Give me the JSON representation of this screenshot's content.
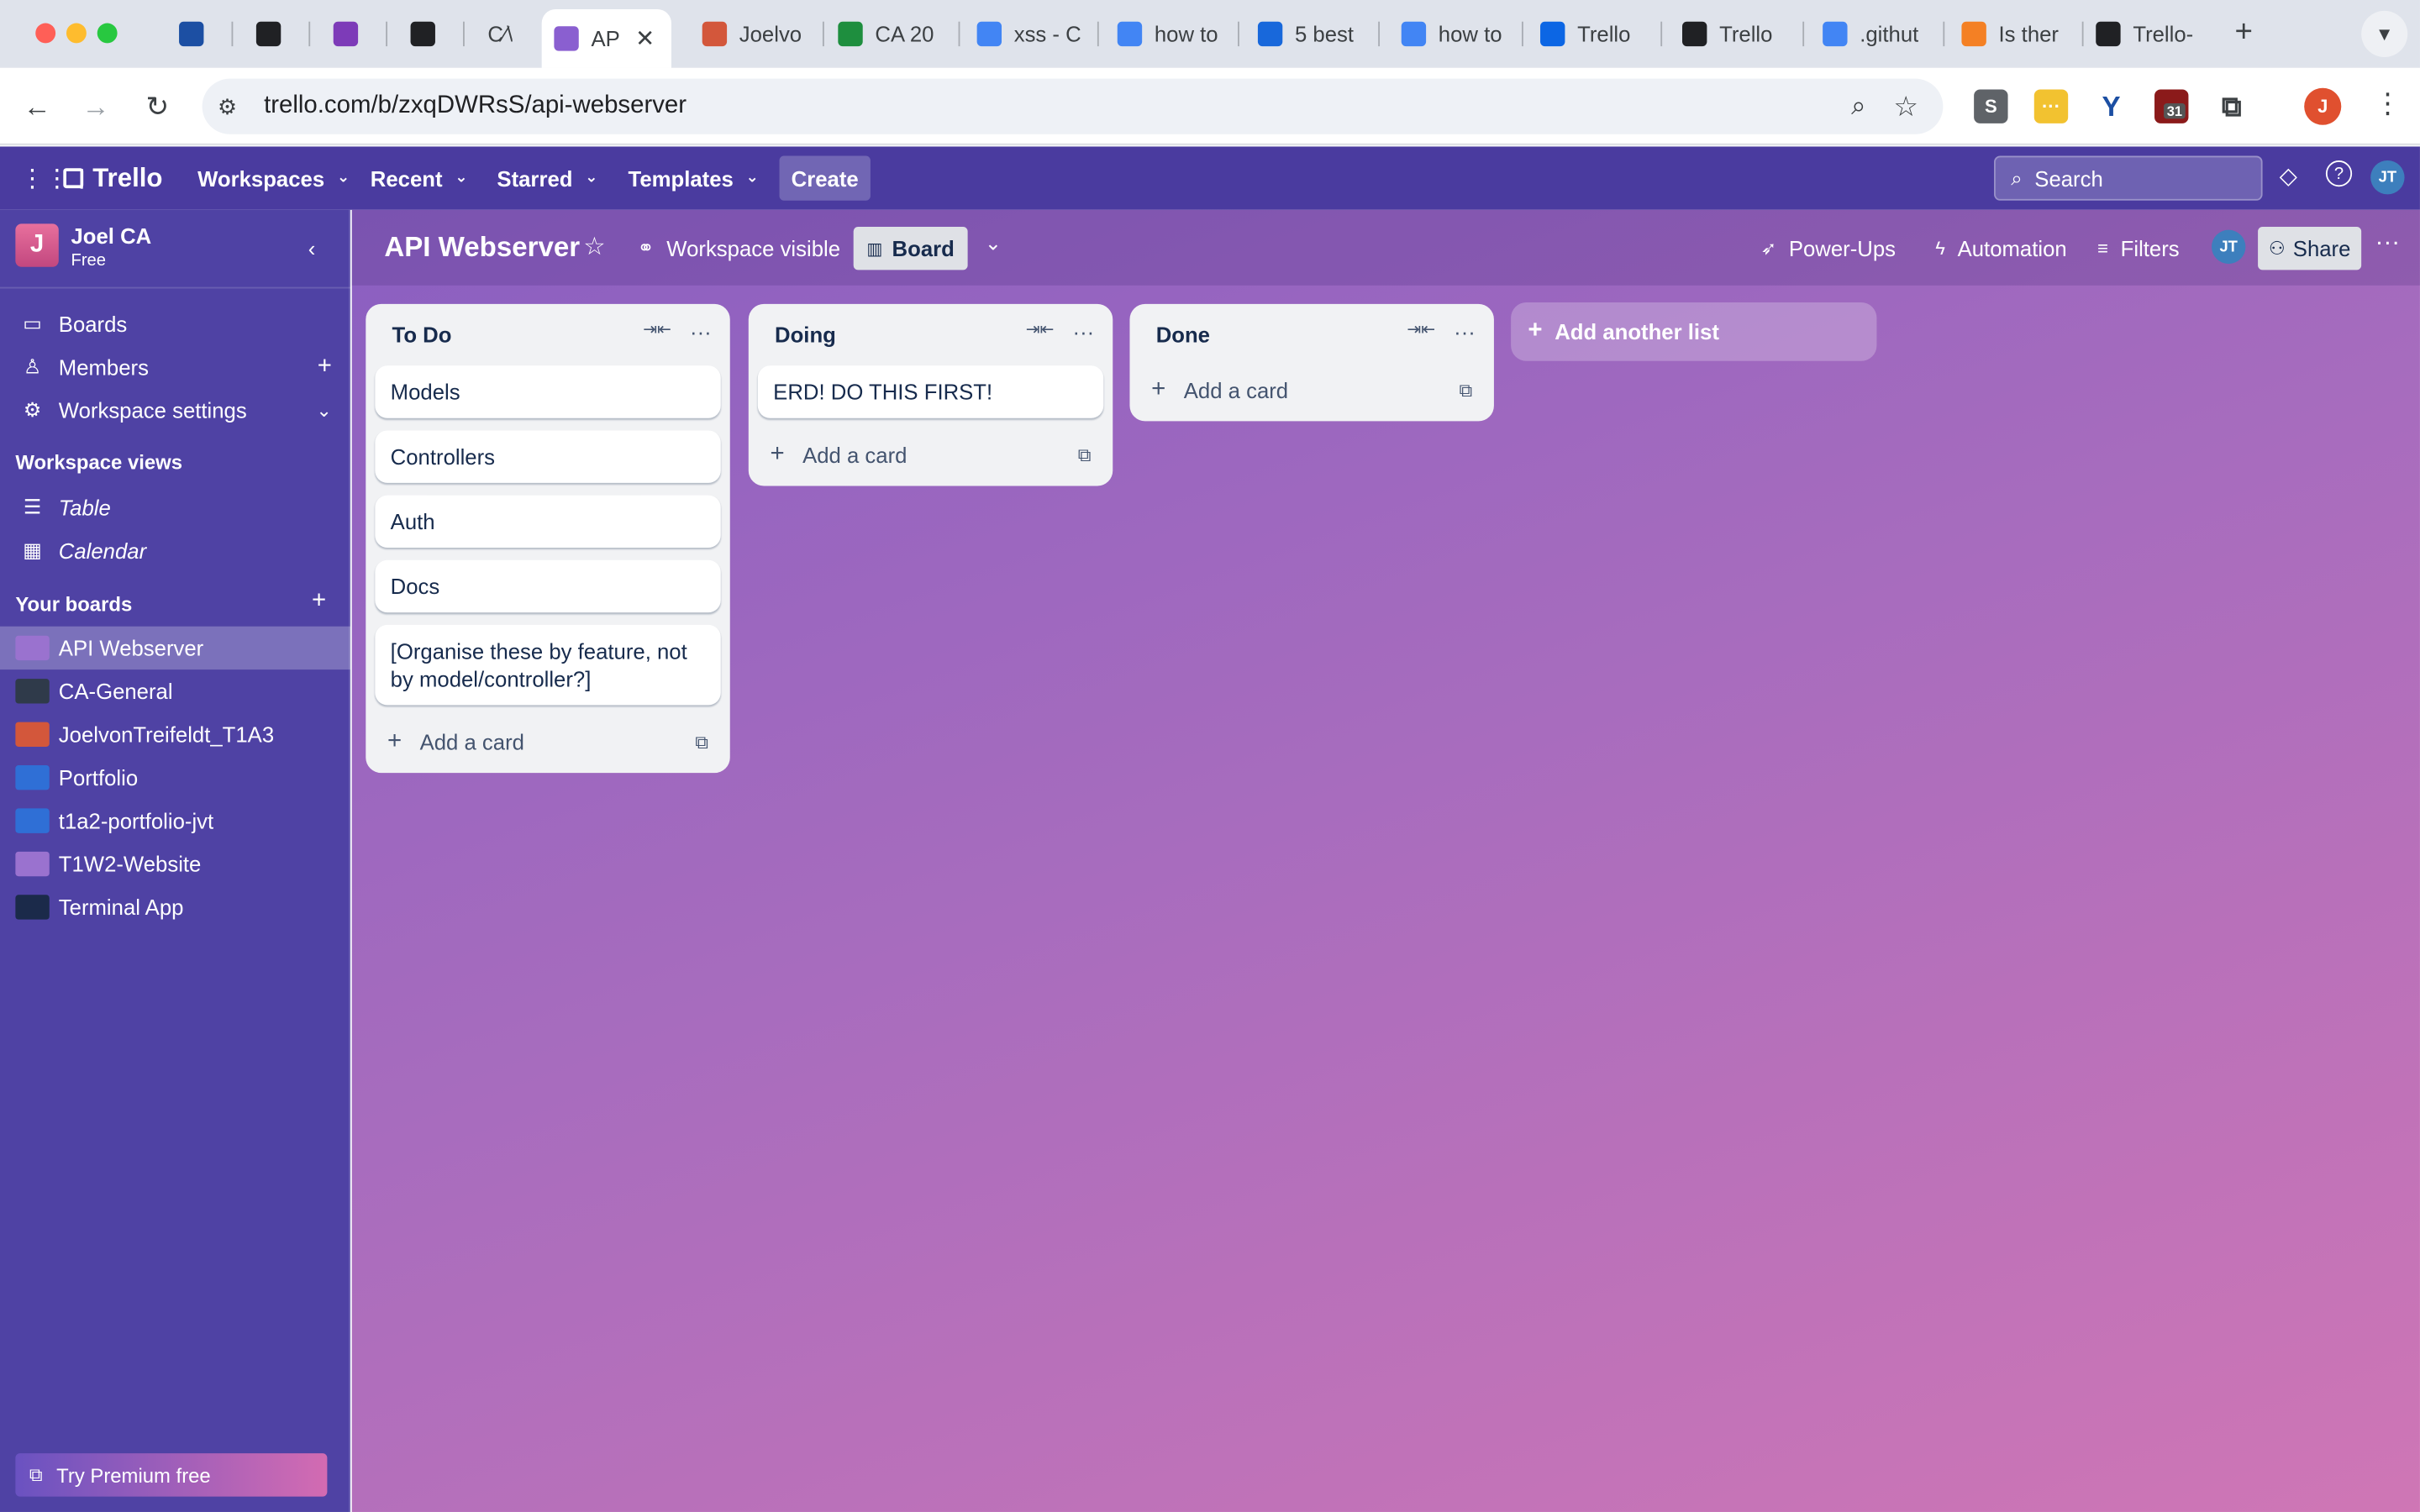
{
  "browser": {
    "tabs": [
      {
        "title": "",
        "icon": "y-logo-icon",
        "color": "#1c4fa3"
      },
      {
        "title": "",
        "icon": "openai-icon",
        "color": "#202124"
      },
      {
        "title": "",
        "icon": "ed-icon",
        "color": "#7d3bb8"
      },
      {
        "title": "",
        "icon": "github-icon",
        "color": "#202124"
      },
      {
        "title": "C⁄\\",
        "icon": "",
        "color": "#888"
      },
      {
        "title": "AP",
        "icon": "trello-icon",
        "color": "#8a5fd0",
        "active": true
      },
      {
        "title": "Joelvo",
        "icon": "trello-orange-icon",
        "color": "#d3573b"
      },
      {
        "title": "CA 20",
        "icon": "sheets-icon",
        "color": "#1e8e3e"
      },
      {
        "title": "xss - C",
        "icon": "google-icon",
        "color": "#4285f4"
      },
      {
        "title": "how to",
        "icon": "google-icon",
        "color": "#4285f4"
      },
      {
        "title": "5 best",
        "icon": "atlassian-icon",
        "color": "#1868db"
      },
      {
        "title": "how to",
        "icon": "google-icon",
        "color": "#4285f4"
      },
      {
        "title": "Trello",
        "icon": "trello-icon",
        "color": "#0c66e4"
      },
      {
        "title": "Trello",
        "icon": "github-icon",
        "color": "#202124"
      },
      {
        "title": ".githut",
        "icon": "google-icon",
        "color": "#4285f4"
      },
      {
        "title": "Is ther",
        "icon": "stackoverflow-icon",
        "color": "#f48024"
      },
      {
        "title": "Trello-",
        "icon": "github-icon",
        "color": "#202124"
      }
    ],
    "url": "trello.com/b/zxqDWRsS/api-webserver",
    "extensions": [
      "S",
      "···",
      "",
      "31",
      ""
    ],
    "profile_initial": "J"
  },
  "header": {
    "app_name": "Trello",
    "menus": [
      "Workspaces",
      "Recent",
      "Starred",
      "Templates"
    ],
    "create_label": "Create",
    "search_placeholder": "Search",
    "avatar": "JT"
  },
  "sidebar": {
    "workspace_initial": "J",
    "workspace_name": "Joel CA",
    "workspace_plan": "Free",
    "nav": [
      {
        "label": "Boards",
        "icon": "board-icon"
      },
      {
        "label": "Members",
        "icon": "person-icon"
      },
      {
        "label": "Workspace settings",
        "icon": "gear-icon"
      }
    ],
    "views_title": "Workspace views",
    "views": [
      {
        "label": "Table",
        "icon": "table-icon"
      },
      {
        "label": "Calendar",
        "icon": "calendar-icon"
      }
    ],
    "boards_title": "Your boards",
    "boards": [
      {
        "label": "API Webserver",
        "color": "#9a72cf",
        "active": true
      },
      {
        "label": "CA-General",
        "color": "#2f3a4a"
      },
      {
        "label": "JoelvonTreifeldt_T1A3",
        "color": "#d3573b"
      },
      {
        "label": "Portfolio",
        "color": "#2f6fd6"
      },
      {
        "label": "t1a2-portfolio-jvt",
        "color": "#2f6fd6"
      },
      {
        "label": "T1W2-Website",
        "color": "#9a72cf"
      },
      {
        "label": "Terminal App",
        "color": "#1b2a4a"
      }
    ],
    "premium_label": "Try Premium free"
  },
  "board": {
    "title": "API Webserver",
    "visibility": "Workspace visible",
    "view": "Board",
    "power_ups": "Power-Ups",
    "automation": "Automation",
    "filters": "Filters",
    "member_avatar": "JT",
    "share": "Share",
    "lists": [
      {
        "title": "To Do",
        "cards": [
          "Models",
          "Controllers",
          "Auth",
          "Docs",
          "[Organise these by feature, not by model/controller?]"
        ]
      },
      {
        "title": "Doing",
        "cards": [
          "ERD! DO THIS FIRST!"
        ]
      },
      {
        "title": "Done",
        "cards": []
      }
    ],
    "add_card_label": "Add a card",
    "add_list_label": "Add another list"
  }
}
